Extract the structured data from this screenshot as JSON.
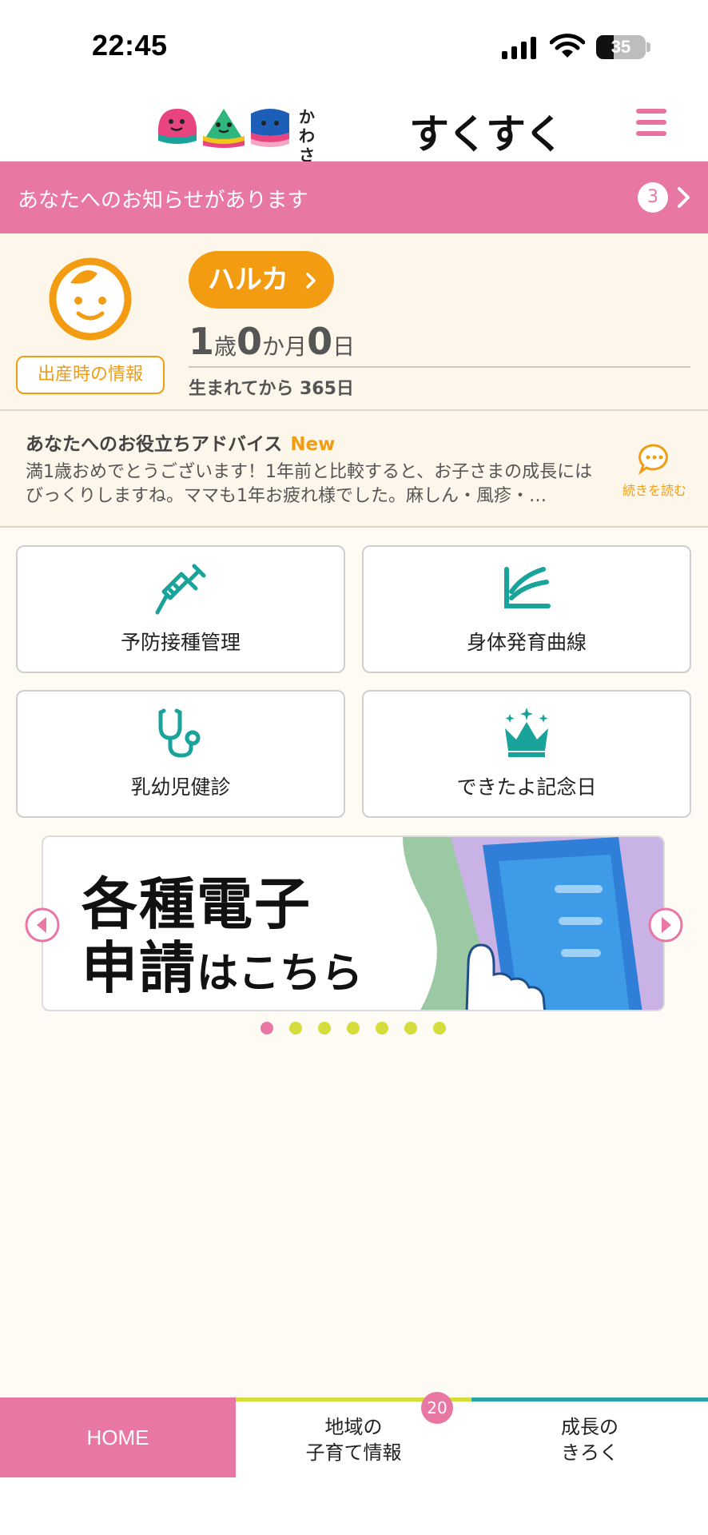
{
  "status_bar": {
    "time": "22:45",
    "battery": "35",
    "battery_level": 0.35
  },
  "header": {
    "logo_small": "かわさき\n子育てアプリ",
    "logo_big": "すくすく"
  },
  "notice": {
    "text": "あなたへのお知らせがあります",
    "count": "3"
  },
  "child": {
    "name": "ハルカ",
    "birth_info_label": "出産時の情報",
    "age": {
      "years": "1",
      "years_unit": "歳",
      "months": "0",
      "months_unit": "か月",
      "days": "0",
      "days_unit": "日"
    },
    "since_birth": "生まれてから 365日"
  },
  "advice": {
    "title": "あなたへのお役立ちアドバイス",
    "new_label": "New",
    "body": "満1歳おめでとうございます！1年前と比較すると、お子さまの成長にはびっくりしますね。ママも1年お疲れ様でした。麻しん・風疹・…",
    "read_more": "続きを読む"
  },
  "tiles": [
    {
      "label": "予防接種管理",
      "icon": "syringe-icon"
    },
    {
      "label": "身体発育曲線",
      "icon": "growth-curve-icon"
    },
    {
      "label": "乳幼児健診",
      "icon": "stethoscope-icon"
    },
    {
      "label": "できたよ記念日",
      "icon": "crown-icon"
    }
  ],
  "banner": {
    "line1": "各種電子",
    "line2a": "申請",
    "line2b": "はこちら"
  },
  "carousel": {
    "total": 7,
    "active": 0
  },
  "bottom_nav": {
    "home": "HOME",
    "area": "地域の\n子育て情報",
    "area_badge": "20",
    "growth": "成長の\nきろく"
  },
  "colors": {
    "pink": "#e977a4",
    "orange": "#f39c12",
    "teal": "#2aa5a5",
    "lime": "#d5dd3a",
    "cream": "#fdf6ea"
  }
}
